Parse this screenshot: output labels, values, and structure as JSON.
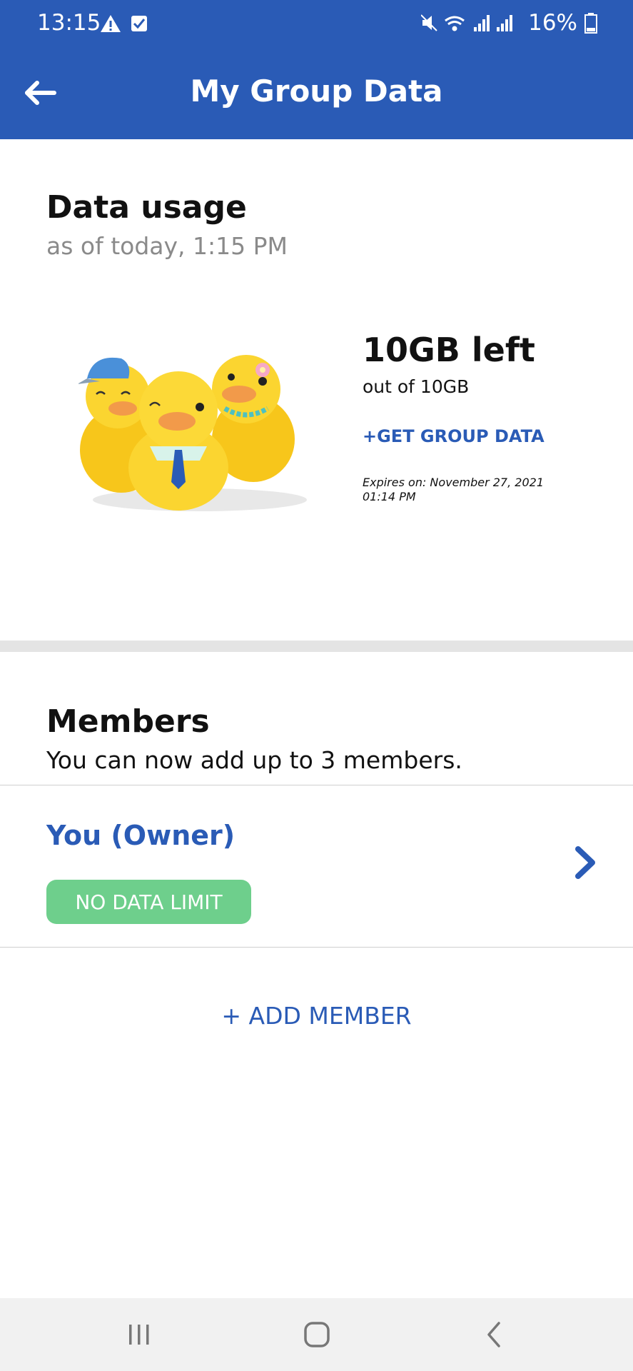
{
  "status_bar": {
    "time": "13:15",
    "battery": "16%",
    "icons": [
      "warning-icon",
      "check-box-icon",
      "mute-icon",
      "wifi-icon",
      "signal-icon",
      "signal-icon",
      "battery-icon"
    ]
  },
  "header": {
    "title": "My Group Data",
    "back_icon": "arrow-left-icon",
    "color": "#2a5bb6"
  },
  "data_usage": {
    "title": "Data usage",
    "as_of": "as of today, 1:15 PM",
    "remaining": "10GB left",
    "total": "out of 10GB",
    "get_data_label": "+GET GROUP DATA",
    "expires_line1": "Expires on: November 27, 2021",
    "expires_line2": "01:14 PM"
  },
  "members": {
    "title": "Members",
    "subtitle": "You can now add up to 3 members.",
    "list": [
      {
        "name": "You (Owner)",
        "badge": "NO DATA LIMIT",
        "badge_color": "#6ecf8c"
      }
    ],
    "add_label": "+ ADD MEMBER"
  },
  "nav": {
    "recents_icon": "recents-icon",
    "home_icon": "home-icon",
    "back_icon": "back-chevron-icon"
  }
}
